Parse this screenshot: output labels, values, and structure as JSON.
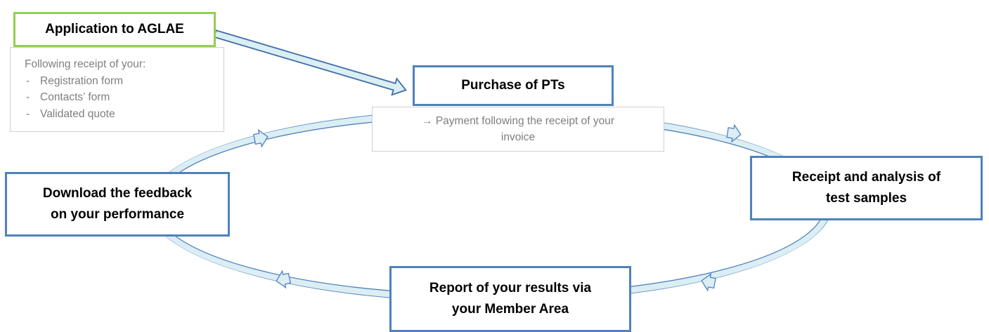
{
  "nodes": {
    "application": {
      "label": "Application to AGLAE"
    },
    "purchase": {
      "label": "Purchase of PTs"
    },
    "receipt": {
      "line1": "Receipt and analysis of",
      "line2": "test samples"
    },
    "report": {
      "line1": "Report of your results via",
      "line2": "your Member Area"
    },
    "download": {
      "line1": "Download the feedback",
      "line2": "on your performance"
    }
  },
  "notes": {
    "application": {
      "title": "Following receipt of your:",
      "items": [
        "Registration form",
        "Contacts’ form",
        "Validated quote"
      ],
      "bullet": "-"
    },
    "purchase": {
      "line1": "→ Payment following the receipt of your",
      "line2": "invoice"
    }
  },
  "colors": {
    "box_border": "#4f81bd",
    "start_border": "#92d050",
    "arrow_fill": "#dbeef4",
    "arrow_stroke": "#4f81bd",
    "note_text": "#7f7f7f",
    "note_border": "#d0d0d0"
  }
}
